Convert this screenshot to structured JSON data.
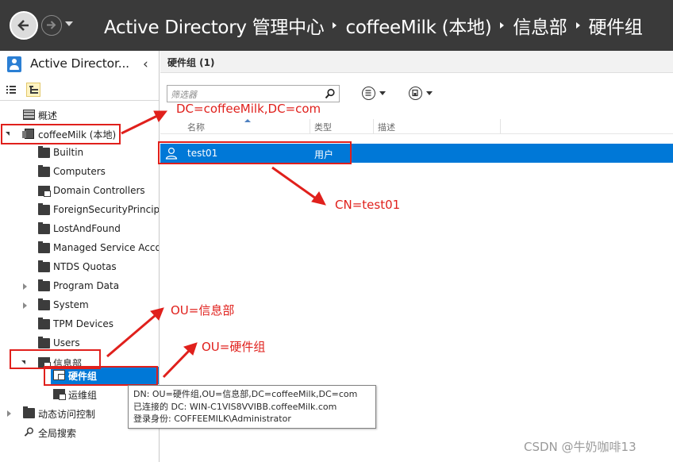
{
  "window": {
    "breadcrumbs": [
      "Active Directory 管理中心",
      "coffeeMilk (本地)",
      "信息部",
      "硬件组"
    ]
  },
  "left_pane": {
    "title": "Active Director...",
    "tree": [
      {
        "label": "概述",
        "icon": "overview-grid-icon"
      },
      {
        "label": "coffeeMilk (本地)",
        "icon": "domain-icon",
        "expanded": true
      },
      {
        "label": "Builtin",
        "icon": "folder-icon"
      },
      {
        "label": "Computers",
        "icon": "folder-icon"
      },
      {
        "label": "Domain Controllers",
        "icon": "ou-icon"
      },
      {
        "label": "ForeignSecurityPrincipa",
        "icon": "folder-icon"
      },
      {
        "label": "LostAndFound",
        "icon": "folder-icon"
      },
      {
        "label": "Managed Service Acco",
        "icon": "folder-icon"
      },
      {
        "label": "NTDS Quotas",
        "icon": "folder-icon"
      },
      {
        "label": "Program Data",
        "icon": "folder-icon",
        "expandable": true
      },
      {
        "label": "System",
        "icon": "folder-icon",
        "expandable": true
      },
      {
        "label": "TPM Devices",
        "icon": "folder-icon"
      },
      {
        "label": "Users",
        "icon": "folder-icon"
      },
      {
        "label": "信息部",
        "icon": "ou-icon",
        "expanded": true
      },
      {
        "label": "硬件组",
        "icon": "ou-icon",
        "selected": true
      },
      {
        "label": "运维组",
        "icon": "ou-icon"
      },
      {
        "label": "动态访问控制",
        "icon": "folder-icon",
        "expandable": true
      },
      {
        "label": "全局搜索",
        "icon": "search-icon"
      }
    ]
  },
  "right_pane": {
    "title": "硬件组  (1)",
    "filter_placeholder": "筛选器",
    "columns": [
      "名称",
      "类型",
      "描述"
    ],
    "rows": [
      {
        "name": "test01",
        "type": "用户",
        "description": ""
      }
    ]
  },
  "annotations": {
    "domain": "DC=coffeeMilk,DC=com",
    "user": "CN=test01",
    "ou_parent": "OU=信息部",
    "ou_child": "OU=硬件组",
    "color": "#e0201c"
  },
  "tooltip": {
    "lines": [
      "DN: OU=硬件组,OU=信息部,DC=coffeeMilk,DC=com",
      "已连接的 DC: WIN-C1VIS8VVIBB.coffeeMilk.com",
      "登录身份: COFFEEMILK\\Administrator"
    ]
  },
  "watermark": "CSDN @牛奶咖啡13"
}
